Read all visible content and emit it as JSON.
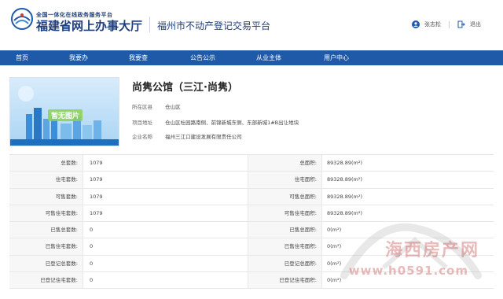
{
  "header": {
    "brand_top": "全国一体化在线政务服务平台",
    "brand_main": "福建省网上办事大厅",
    "platform_title": "福州市不动产登记交易平台",
    "user_name": "张志松",
    "logout_label": "退出"
  },
  "nav": {
    "items": [
      {
        "label": "首页"
      },
      {
        "label": "我要办"
      },
      {
        "label": "我要查"
      },
      {
        "label": "公告公示"
      },
      {
        "label": "从业主体"
      },
      {
        "label": "用户中心"
      }
    ]
  },
  "project": {
    "title": "尚隽公馆（三江·尚隽）",
    "cover_caption": "暂无图片",
    "fields": [
      {
        "label": "所在区县",
        "value": "仓山区"
      },
      {
        "label": "项目地址",
        "value": "仓山区杜园路南侧、前锦新城东侧、东部新城1#B出让地块"
      },
      {
        "label": "企业名称",
        "value": "福州三江口建设发展有限责任公司"
      }
    ]
  },
  "stats": {
    "rows": [
      {
        "l1": "总套数:",
        "v1": "1079",
        "l2": "总面积:",
        "v2": "89328.89(m²)"
      },
      {
        "l1": "住宅套数:",
        "v1": "1079",
        "l2": "住宅面积:",
        "v2": "89328.89(m²)"
      },
      {
        "l1": "可售套数:",
        "v1": "1079",
        "l2": "可售总面积:",
        "v2": "89328.89(m²)"
      },
      {
        "l1": "可售住宅套数:",
        "v1": "1079",
        "l2": "可售住宅面积:",
        "v2": "89328.89(m²)"
      },
      {
        "l1": "已售总套数:",
        "v1": "0",
        "l2": "已售总面积:",
        "v2": "0(m²)"
      },
      {
        "l1": "已售住宅套数:",
        "v1": "0",
        "l2": "已售住宅面积:",
        "v2": "0(m²)"
      },
      {
        "l1": "已登记总套数:",
        "v1": "0",
        "l2": "已登记总面积:",
        "v2": "0(m²)"
      },
      {
        "l1": "已登记住宅套数:",
        "v1": "0",
        "l2": "已登记住宅面积:",
        "v2": "0(m²)"
      }
    ]
  },
  "watermark": {
    "line1": "海西房产网",
    "line2": "www.h0591.com"
  },
  "colors": {
    "nav_bg": "#1f5aa8",
    "brand": "#1f3f7a"
  }
}
